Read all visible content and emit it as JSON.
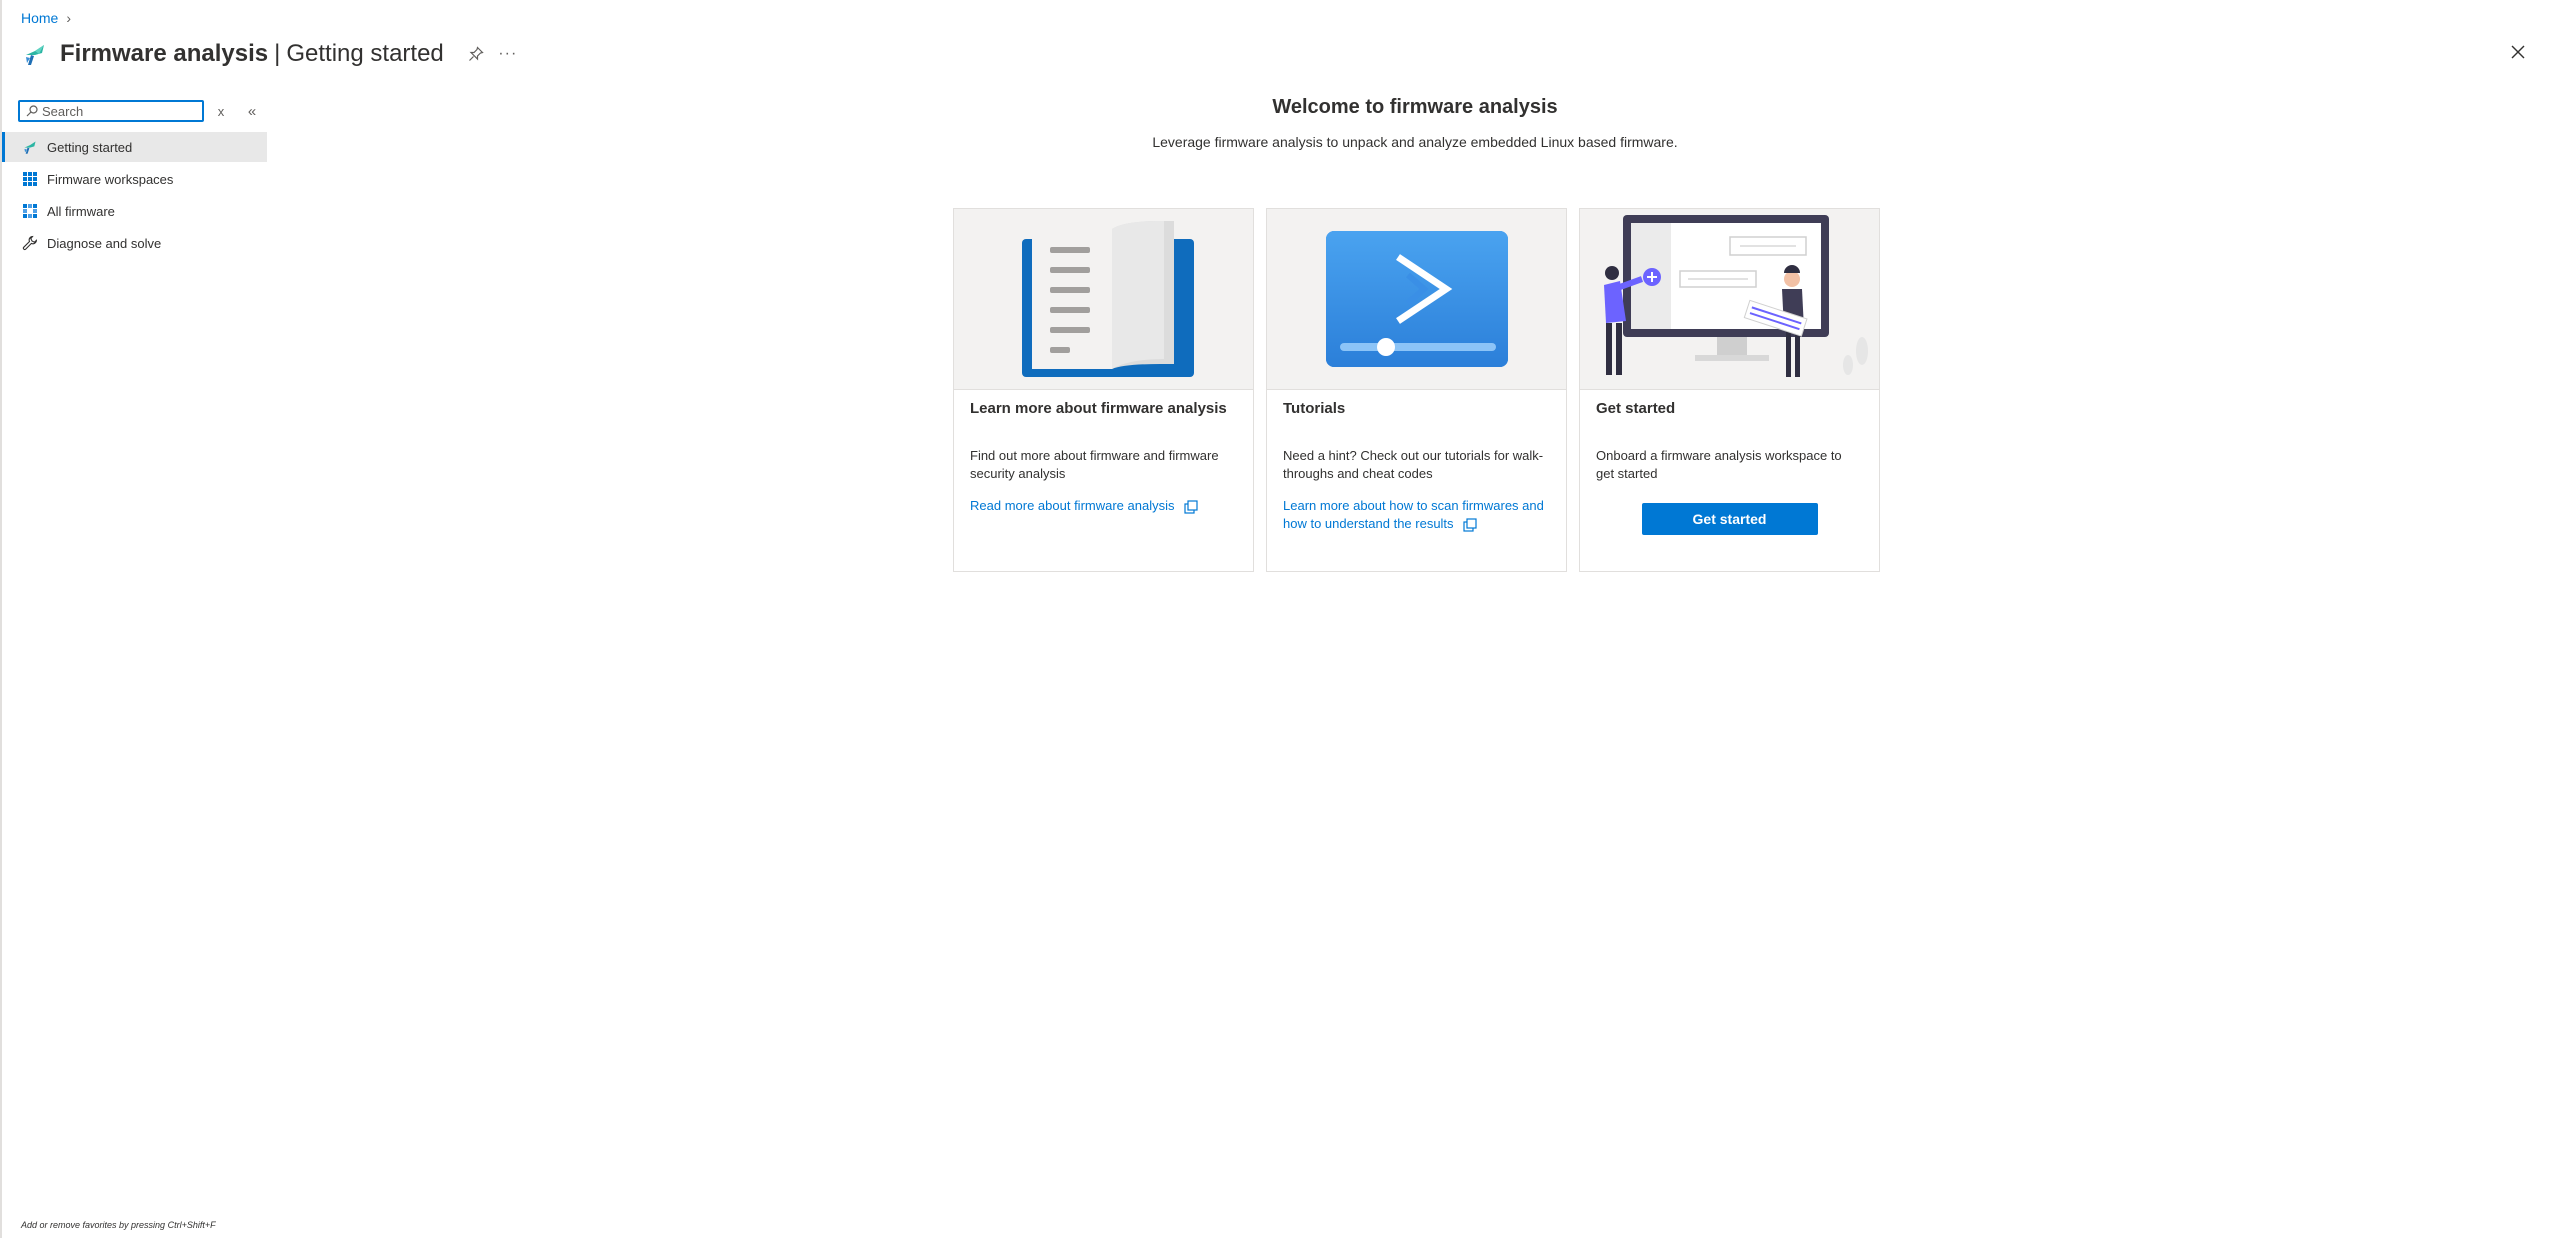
{
  "breadcrumb": {
    "home": "Home",
    "separator": "›"
  },
  "header": {
    "title_main": "Firmware analysis",
    "title_sep": "|",
    "title_section": "Getting started",
    "pin_icon": "pin-icon",
    "more_label": "···",
    "close_icon": "close-icon"
  },
  "sidebar": {
    "search_placeholder": "Search",
    "clear_label": "x",
    "collapse_label": "«",
    "items": [
      {
        "label": "Getting started",
        "icon": "firmware-logo-icon",
        "active": true
      },
      {
        "label": "Firmware workspaces",
        "icon": "grid-icon",
        "active": false
      },
      {
        "label": "All firmware",
        "icon": "list-grid-icon",
        "active": false
      },
      {
        "label": "Diagnose and solve",
        "icon": "wrench-icon",
        "active": false
      }
    ]
  },
  "main": {
    "title": "Welcome to firmware analysis",
    "subtitle": "Leverage firmware analysis to unpack and analyze embedded Linux based firmware.",
    "cards": [
      {
        "title": "Learn more about firmware analysis",
        "description": "Find out more about firmware and firmware security analysis",
        "link": "Read more about firmware analysis"
      },
      {
        "title": "Tutorials",
        "description": "Need a hint? Check out our tutorials for walk-throughs and cheat codes",
        "link": "Learn more about how to scan firmwares and how to understand the results"
      },
      {
        "title": "Get started",
        "description": "Onboard a firmware analysis workspace to get started",
        "button": "Get started"
      }
    ]
  },
  "footer": {
    "hint": "Add or remove favorites by pressing Ctrl+Shift+F"
  },
  "colors": {
    "accent": "#0078d4",
    "sidebar_active_bg": "#e8e8e8",
    "logo_teal": "#2bb5a3"
  }
}
